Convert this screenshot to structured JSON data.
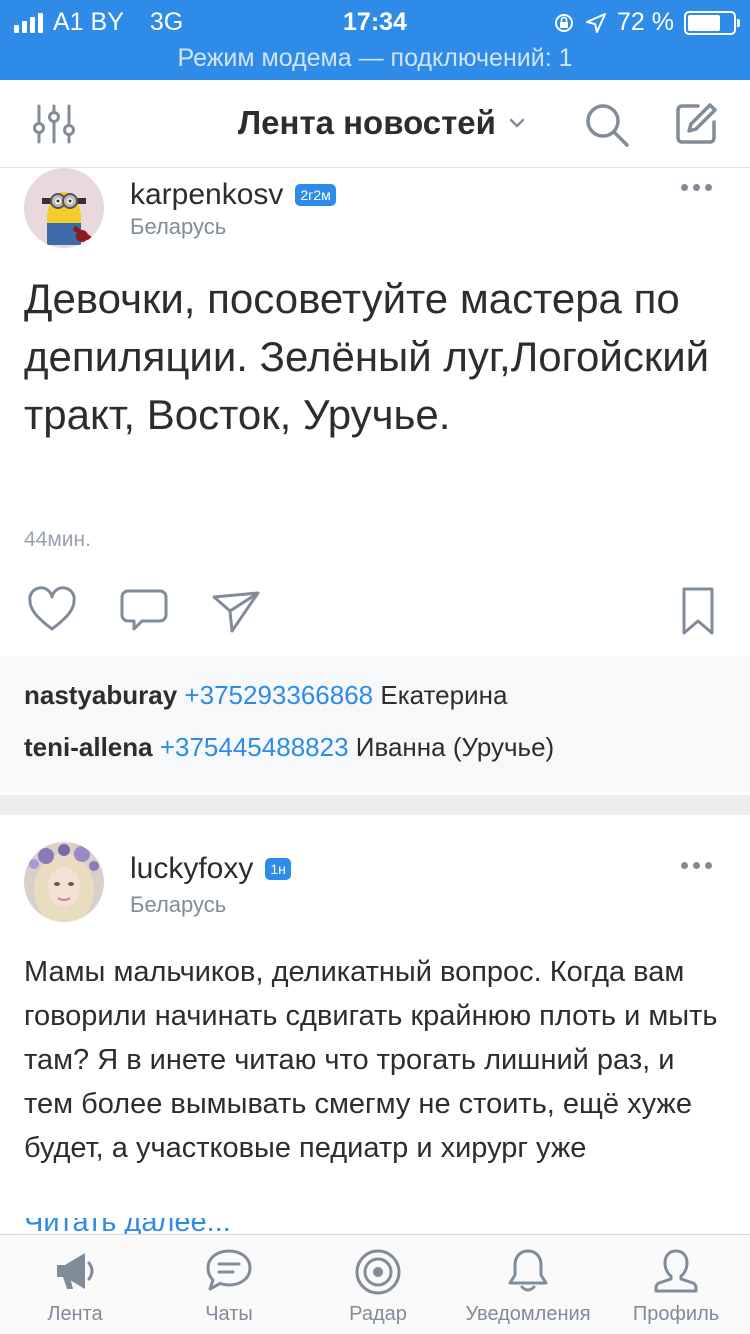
{
  "status_bar": {
    "carrier": "A1 BY",
    "network": "3G",
    "time": "17:34",
    "battery_percent": "72 %",
    "battery_level": 0.72,
    "hotspot_text": "Режим модема — подключений: 1",
    "bg_color": "#2f8be8"
  },
  "header": {
    "title": "Лента новостей",
    "left_icon": "filter-sliders-icon",
    "right_icons": [
      "search-icon",
      "compose-icon"
    ]
  },
  "posts": [
    {
      "author": "karpenkosv",
      "badge": "2г2м",
      "location": "Беларусь",
      "text": "Девочки, посоветуйте мастера по депиляции. Зелёный луг,Логойский тракт, Восток, Уручье.",
      "time": "44мин.",
      "comments": [
        {
          "user": "nastyaburay",
          "phone": "+375293366868",
          "text": "Екатерина"
        },
        {
          "user": "teni-allena",
          "phone": "+375445488823",
          "text": "Иванна (Уручье)"
        }
      ]
    },
    {
      "author": "luckyfoxy",
      "badge": "1н",
      "location": "Беларусь",
      "text": "Мамы мальчиков, деликатный вопрос. Когда вам говорили начинать сдвигать крайнюю плоть и мыть там? Я в инете читаю что трогать лишний раз, и тем более вымывать смегму не стоить, ещё хуже будет, а участковые педиатр и хирург уже",
      "read_more": "Читать далее..."
    }
  ],
  "tabs": [
    {
      "label": "Лента",
      "icon": "megaphone-icon"
    },
    {
      "label": "Чаты",
      "icon": "chat-bubble-icon"
    },
    {
      "label": "Радар",
      "icon": "radar-icon"
    },
    {
      "label": "Уведомления",
      "icon": "bell-icon"
    },
    {
      "label": "Профиль",
      "icon": "person-icon"
    }
  ],
  "colors": {
    "accent": "#2f8be8",
    "text": "#2c2d2e",
    "secondary": "#818c99"
  }
}
